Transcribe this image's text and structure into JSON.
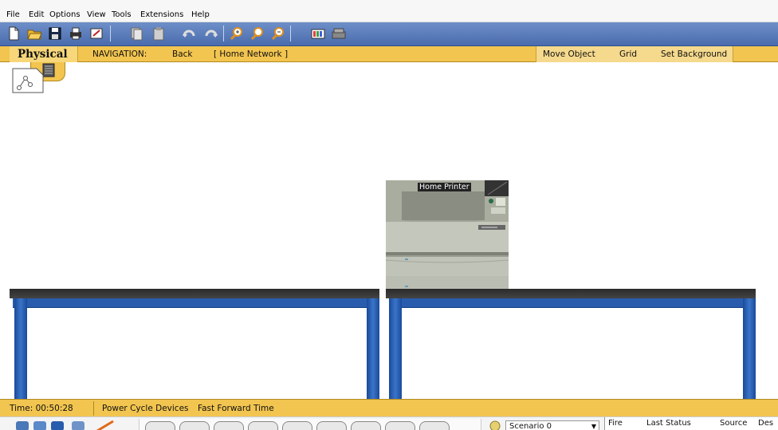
{
  "menu": [
    "File",
    "Edit",
    "Options",
    "View",
    "Tools",
    "Extensions",
    "Help"
  ],
  "toolbar": {
    "buttons": [
      "new-icon",
      "open-icon",
      "save-icon",
      "print-icon",
      "activity-wizard-icon",
      "copy-icon",
      "paste-icon",
      "undo-icon",
      "redo-icon",
      "zoom-in-icon",
      "zoom-reset-icon",
      "zoom-out-icon",
      "palette-icon",
      "custom-device-icon"
    ]
  },
  "navbar": {
    "mode": "Physical",
    "nav_label": "NAVIGATION:",
    "back": "Back",
    "location": "[ Home Network ]",
    "move_object": "Move Object",
    "grid": "Grid",
    "set_background": "Set Background"
  },
  "workspace": {
    "device_label": "Home Printer"
  },
  "status": {
    "time": "Time: 00:50:28",
    "power_cycle": "Power Cycle Devices",
    "fast_forward": "Fast Forward Time"
  },
  "bottom": {
    "scenario": "Scenario 0",
    "pdu_columns": [
      "Fire",
      "Last Status",
      "Source",
      "Des"
    ]
  },
  "colors": {
    "toolbar_blue": "#4a6cad",
    "nav_gold": "#f2c550",
    "table_blue": "#2a5cad"
  }
}
